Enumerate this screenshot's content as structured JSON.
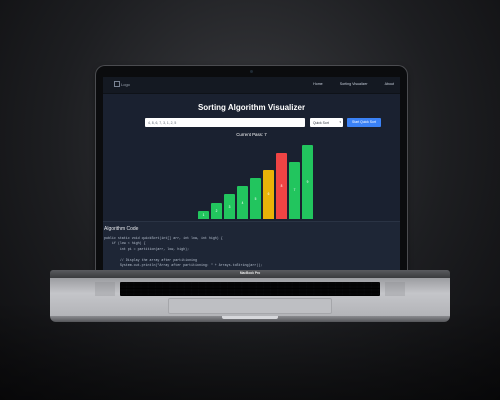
{
  "nav": {
    "logo_alt": "Logo",
    "links": [
      "Home",
      "Sorting Visualizer",
      "About"
    ]
  },
  "app": {
    "title": "Sorting Algorithm Visualizer",
    "array_input_value": "4, 8, 6, 7, 3, 1, 2, 5",
    "algorithm_select_value": "Quick Sort",
    "start_button_label": "Start Quick Sort",
    "current_pass_label": "Current Pass: 7"
  },
  "bars": [
    {
      "label": "1",
      "value": 1,
      "color": "#22c55e"
    },
    {
      "label": "2",
      "value": 2,
      "color": "#22c55e"
    },
    {
      "label": "3",
      "value": 3,
      "color": "#22c55e"
    },
    {
      "label": "4",
      "value": 4,
      "color": "#22c55e"
    },
    {
      "label": "5",
      "value": 5,
      "color": "#22c55e"
    },
    {
      "label": "6",
      "value": 6,
      "color": "#eab308"
    },
    {
      "label": "8",
      "value": 8,
      "color": "#ef4444"
    },
    {
      "label": "7",
      "value": 7,
      "color": "#22c55e"
    },
    {
      "label": "9",
      "value": 9,
      "color": "#22c55e"
    }
  ],
  "code_panel": {
    "heading": "Algorithm Code",
    "lines": [
      "public static void quickSort(int[] arr, int low, int high) {",
      "    if (low < high) {",
      "        int pi = partition(arr, low, high);",
      "",
      "        // Display the array after partitioning",
      "        System.out.println(\"Array after partitioning: \" + Arrays.toString(arr));"
    ]
  },
  "laptop": {
    "brand_label": "MacBook Pro"
  }
}
